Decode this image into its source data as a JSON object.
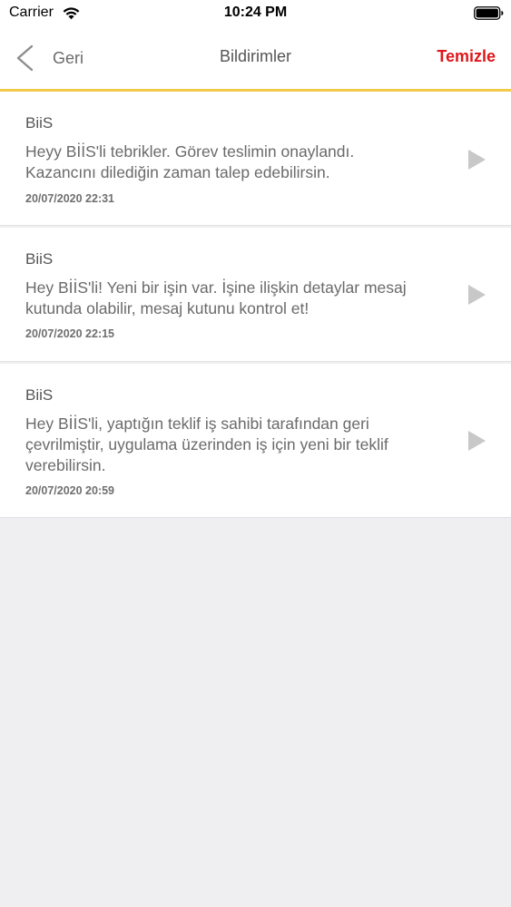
{
  "status_bar": {
    "carrier": "Carrier",
    "time": "10:24 PM",
    "wifi_icon": "wifi-icon",
    "battery_icon": "battery-icon"
  },
  "nav": {
    "back_label": "Geri",
    "title": "Bildirimler",
    "clear_label": "Temizle",
    "accent_color": "#e0161b",
    "divider_color": "#f2c94c"
  },
  "notifications": [
    {
      "sender": "BiiS",
      "message": "Heyy BİİS'li tebrikler. Görev teslimin onaylandı. Kazancını dilediğin zaman talep edebilirsin.",
      "date": "20/07/2020 22:31"
    },
    {
      "sender": "BiiS",
      "message": "Hey BİİS'li! Yeni bir işin var. İşine ilişkin detaylar mesaj kutunda olabilir, mesaj kutunu kontrol et!",
      "date": "20/07/2020 22:15"
    },
    {
      "sender": "BiiS",
      "message": "Hey BİİS'li, yaptığın teklif iş sahibi tarafından geri çevrilmiştir, uygulama üzerinden iş için yeni bir teklif verebilirsin.",
      "date": "20/07/2020 20:59"
    }
  ]
}
